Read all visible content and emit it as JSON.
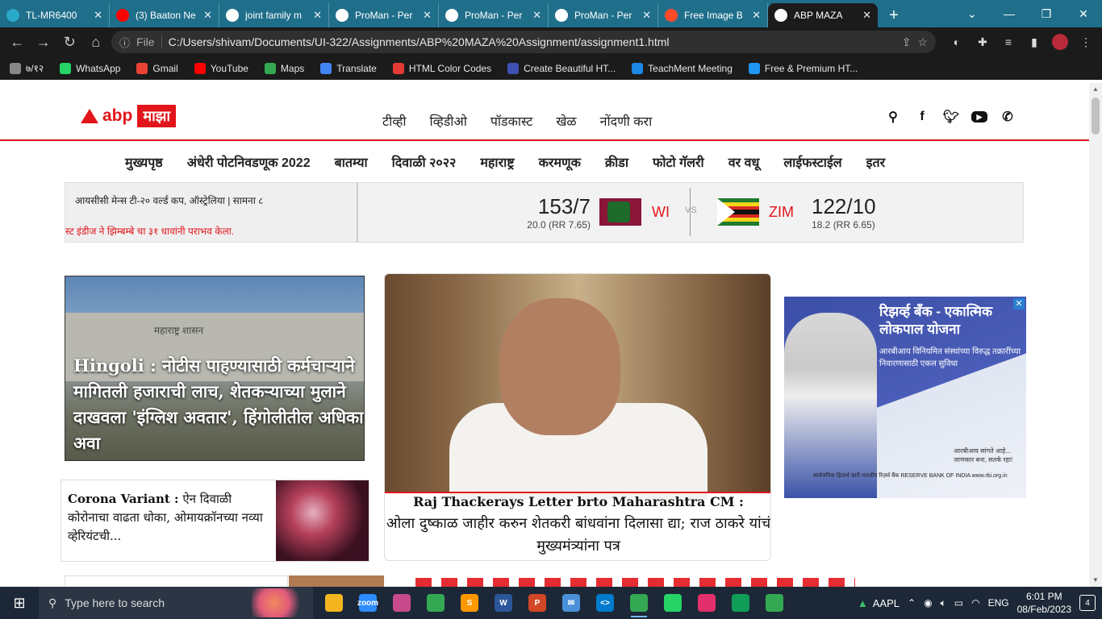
{
  "browser": {
    "tabs": [
      {
        "title": "TL-MR6400",
        "icon": "tp-link-icon",
        "color": "#2aa9c9"
      },
      {
        "title": "(3) Baaton Ne",
        "icon": "youtube-icon",
        "color": "#ff0000"
      },
      {
        "title": "joint family m",
        "icon": "google-icon",
        "color": "#ffffff"
      },
      {
        "title": "ProMan - Per",
        "icon": "globe-icon",
        "color": "#ffffff"
      },
      {
        "title": "ProMan - Per",
        "icon": "globe-icon",
        "color": "#ffffff"
      },
      {
        "title": "ProMan - Per",
        "icon": "globe-icon",
        "color": "#ffffff"
      },
      {
        "title": "Free Image B",
        "icon": "image-host-icon",
        "color": "#ff4a2a"
      },
      {
        "title": "ABP MAZA",
        "icon": "globe-icon",
        "color": "#ffffff",
        "active": true
      }
    ],
    "new_tab": "+",
    "address": {
      "info_label": "ⓘ",
      "scheme_label": "File",
      "url": "C:/Users/shivam/Documents/UI-322/Assignments/ABP%20MAZA%20Assignment/assignment1.html"
    },
    "bookmarks": [
      {
        "label": "७/१२",
        "icon": "bookmark-icon",
        "color": "#888888"
      },
      {
        "label": "WhatsApp",
        "icon": "whatsapp-icon",
        "color": "#25d366"
      },
      {
        "label": "Gmail",
        "icon": "gmail-icon",
        "color": "#ea4335"
      },
      {
        "label": "YouTube",
        "icon": "youtube-icon",
        "color": "#ff0000"
      },
      {
        "label": "Maps",
        "icon": "maps-icon",
        "color": "#34a853"
      },
      {
        "label": "Translate",
        "icon": "translate-icon",
        "color": "#4285f4"
      },
      {
        "label": "HTML Color Codes",
        "icon": "color-codes-icon",
        "color": "#e53935"
      },
      {
        "label": "Create Beautiful HT...",
        "icon": "codepen-icon",
        "color": "#3f51b5"
      },
      {
        "label": "TeachMent Meeting",
        "icon": "teachment-icon",
        "color": "#1e88e5"
      },
      {
        "label": "Free & Premium HT...",
        "icon": "template-icon",
        "color": "#2196f3"
      }
    ]
  },
  "site": {
    "logo_text": "abp",
    "logo_badge": "माझा",
    "brand_color": "#e2151b",
    "top_nav": [
      "टीव्ही",
      "व्हिडीओ",
      "पॉडकास्ट",
      "खेळ",
      "नोंदणी करा"
    ],
    "main_nav": [
      "मुख्यपृष्ठ",
      "अंधेरी पोटनिवडणूक 2022",
      "बातम्या",
      "दिवाळी २०२२",
      "महाराष्ट्र",
      "करमणूक",
      "क्रीडा",
      "फोटो गॅलरी",
      "वर वधू",
      "लाईफस्टाईल",
      "इतर"
    ]
  },
  "ticker": {
    "series": "आयसीसी मेन्स टी-२० वर्ल्ड कप, ऑस्ट्रेलिया | सामना ८",
    "result": "स्ट इंडीज ने झिम्बम्बे चा ३१ धावांनी पराभव केला.",
    "team1": {
      "code": "WI",
      "score": "153/7",
      "overs": "20.0 (RR 7.65)"
    },
    "vs": "VS",
    "team2": {
      "code": "ZIM",
      "score": "122/10",
      "overs": "18.2 (RR 6.65)"
    }
  },
  "stories": {
    "left": {
      "sign": "महाराष्ट्र  शासन",
      "keyword": "Hingoli :",
      "headline": "नोटीस पाहण्यासाठी कर्मचाऱ्याने मागितली हजाराची लाच, शेतकऱ्याच्या मुलाने दाखवला 'इंग्लिश अवतार', हिंगोलीतील अधिकारी अवा"
    },
    "small": {
      "keyword": "Corona Variant :",
      "headline": "ऐन दिवाळी कोरोनाचा वाढता धोका, ओमायक्रॉनच्या नव्या व्हेरियंटची..."
    },
    "main": {
      "caption_en": "Raj Thackerays Letter brto Maharashtra CM :",
      "caption_mr": "ओला दुष्काळ जाहीर करुन शेतकरी बांधवांना दिलासा द्या; राज ठाकरे यांचं मुख्यमंत्र्यांना पत्र"
    }
  },
  "ad": {
    "title": "रिझर्व्ह बॅंक - एकात्मिक लोकपाल योजना",
    "subtitle": "आरबीआय विनियमित संस्थांच्या विरुद्ध तक्रारींच्या निवारणासाठी एकल सुविधा",
    "tagline": "आरबीआय सांगते आहे... जाणकार बना, सतर्क रहा!",
    "footer": "सार्वजनिक हितार्थ जारी भारतीय रिज़र्व बैंक RESERVE BANK OF INDIA www.rbi.org.in",
    "close": "✕"
  },
  "taskbar": {
    "search_placeholder": "Type here to search",
    "apps": [
      {
        "icon": "file-explorer-icon",
        "color": "#f2b51e",
        "label": ""
      },
      {
        "icon": "zoom-icon",
        "color": "#2d8cff",
        "label": "zoom"
      },
      {
        "icon": "snipping-tool-icon",
        "color": "#c74b8c",
        "label": ""
      },
      {
        "icon": "chrome-icon",
        "color": "#34a853",
        "label": ""
      },
      {
        "icon": "sublime-text-icon",
        "color": "#ff9800",
        "label": "S"
      },
      {
        "icon": "word-icon",
        "color": "#2b579a",
        "label": "W"
      },
      {
        "icon": "powerpoint-icon",
        "color": "#d24726",
        "label": "P"
      },
      {
        "icon": "mail-icon",
        "color": "#4a90d9",
        "label": "✉"
      },
      {
        "icon": "vscode-icon",
        "color": "#007acc",
        "label": "<>"
      },
      {
        "icon": "chrome-profile-icon",
        "color": "#34a853",
        "label": "",
        "active": true
      },
      {
        "icon": "whatsapp-icon",
        "color": "#25d366",
        "label": ""
      },
      {
        "icon": "instagram-icon",
        "color": "#e1306c",
        "label": ""
      },
      {
        "icon": "edge-icon",
        "color": "#0f9d58",
        "label": ""
      },
      {
        "icon": "chrome-profile-2-icon",
        "color": "#34a853",
        "label": ""
      }
    ],
    "stock": "AAPL",
    "language": "ENG",
    "time": "6:01 PM",
    "date": "08/Feb/2023",
    "notifications": "4"
  }
}
